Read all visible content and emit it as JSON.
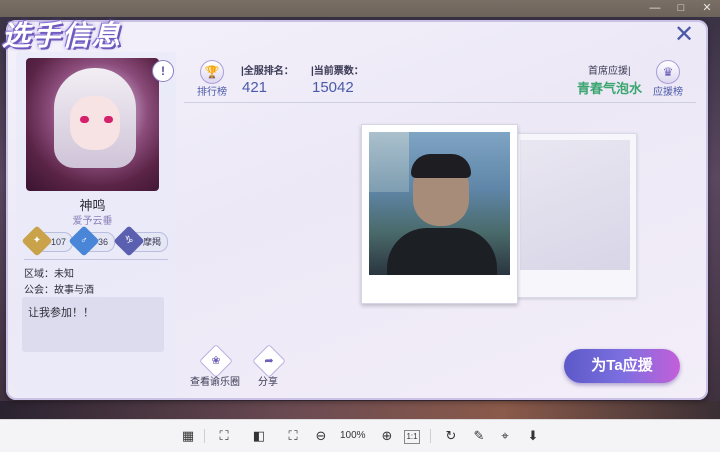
{
  "window": {
    "controls": [
      "minimize",
      "maximize",
      "close"
    ]
  },
  "dialog": {
    "title": "选手信息",
    "close_symbol": "✕"
  },
  "player": {
    "name": "神鸣",
    "subtitle": "爱予云垂",
    "badges": [
      {
        "icon": "star-badge-icon",
        "value": "107",
        "color": "#c9a24a"
      },
      {
        "icon": "male-badge-icon",
        "value": "36",
        "color": "#4a86d8"
      },
      {
        "icon": "role-badge-icon",
        "value": "摩羯",
        "color": "#5a5fb0"
      }
    ],
    "region_label": "区域：",
    "region_value": "未知",
    "guild_label": "公会：",
    "guild_value": "故事与酒",
    "message": "让我参加！！"
  },
  "stats": {
    "leaderboard_label": "排行榜",
    "rank_label": "|全服排名：",
    "rank_value": "421",
    "votes_label": "|当前票数：",
    "votes_value": "15042",
    "top_supporter_label": "首席应援|",
    "top_supporter_name": "青春气泡水",
    "support_list_label": "应援榜"
  },
  "actions": {
    "moments_label": "查看谕乐圈",
    "share_label": "分享",
    "cheer_label": "为Ta应援"
  },
  "toolbar": {
    "zoom": "100%",
    "fit_label": "1:1"
  },
  "colors": {
    "accent": "#5d59c8",
    "highlight_name": "#3aa56f",
    "stat_value": "#4b5aa8"
  }
}
